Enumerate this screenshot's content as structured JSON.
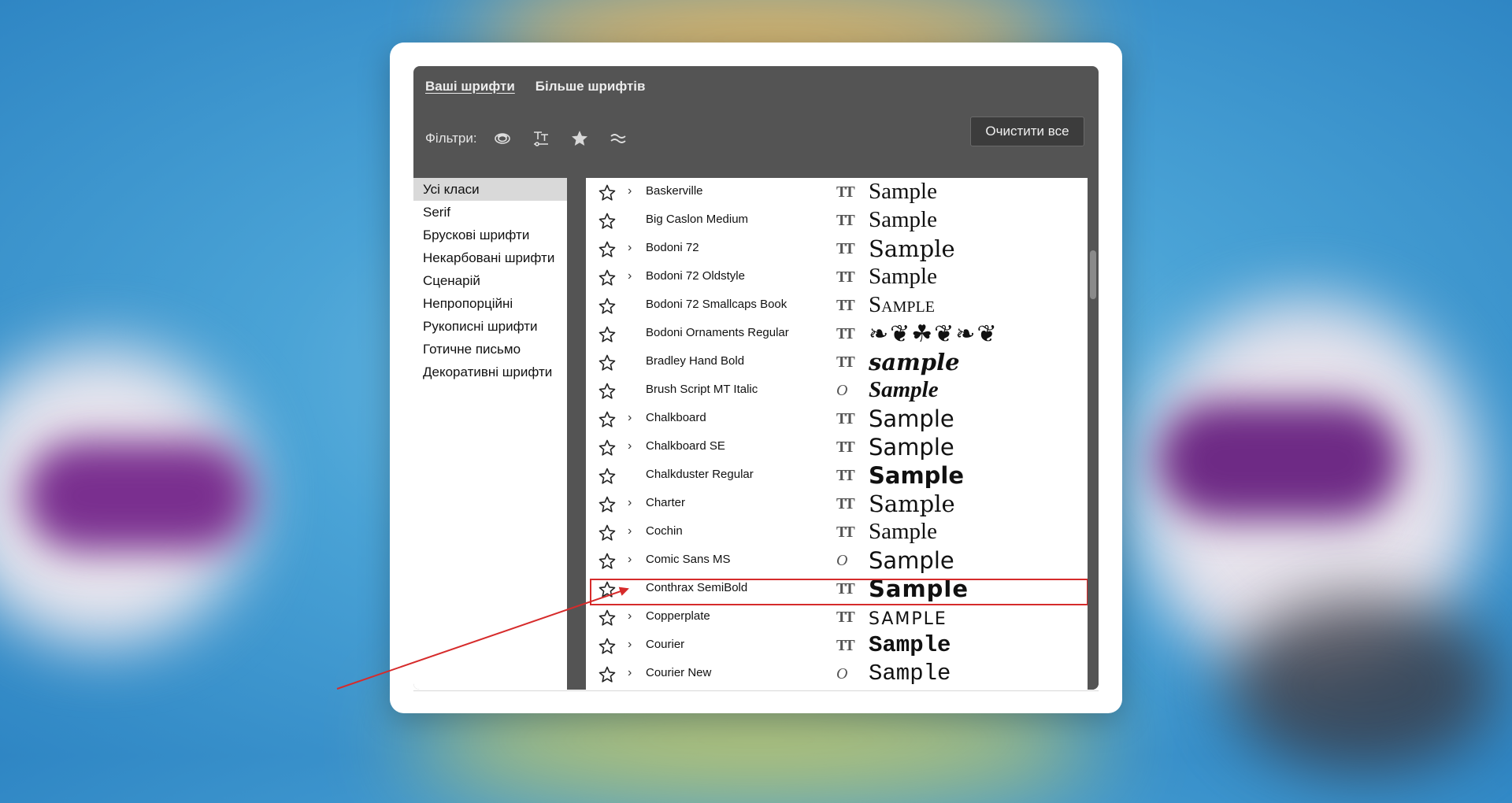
{
  "tabs": [
    {
      "label": "Ваші шрифти",
      "active": true
    },
    {
      "label": "Більше шрифтів",
      "active": false
    }
  ],
  "filters": {
    "label": "Фільтри:",
    "icons": [
      "creative-cloud-icon",
      "text-tool-icon",
      "star-icon",
      "similar-icon"
    ]
  },
  "clear_button": "Очистити все",
  "classes": [
    "Усі класи",
    "Serif",
    "Брускові шрифти",
    "Некарбовані шрифти",
    "Сценарій",
    "Непропорційні",
    "Рукописні шрифти",
    "Готичне письмо",
    "Декоративні шрифти"
  ],
  "selected_class": "Усі класи",
  "fonts": [
    {
      "name": "Baskerville",
      "expandable": true,
      "type": "truetype",
      "sample": "Sample"
    },
    {
      "name": "Big Caslon Medium",
      "expandable": false,
      "type": "truetype",
      "sample": "Sample"
    },
    {
      "name": "Bodoni 72",
      "expandable": true,
      "type": "truetype",
      "sample": "Sample"
    },
    {
      "name": "Bodoni 72 Oldstyle",
      "expandable": true,
      "type": "truetype",
      "sample": "Sample"
    },
    {
      "name": "Bodoni 72 Smallcaps Book",
      "expandable": false,
      "type": "truetype",
      "sample": "Sample"
    },
    {
      "name": "Bodoni Ornaments Regular",
      "expandable": false,
      "type": "truetype",
      "sample": "❧❦☘❦❧❦"
    },
    {
      "name": "Bradley Hand Bold",
      "expandable": false,
      "type": "truetype",
      "sample": "sample"
    },
    {
      "name": "Brush Script MT Italic",
      "expandable": false,
      "type": "opentype",
      "sample": "Sample"
    },
    {
      "name": "Chalkboard",
      "expandable": true,
      "type": "truetype",
      "sample": "Sample"
    },
    {
      "name": "Chalkboard SE",
      "expandable": true,
      "type": "truetype",
      "sample": "Sample"
    },
    {
      "name": "Chalkduster Regular",
      "expandable": false,
      "type": "truetype",
      "sample": "Sample"
    },
    {
      "name": "Charter",
      "expandable": true,
      "type": "truetype",
      "sample": "Sample"
    },
    {
      "name": "Cochin",
      "expandable": true,
      "type": "truetype",
      "sample": "Sample"
    },
    {
      "name": "Comic Sans MS",
      "expandable": true,
      "type": "opentype",
      "sample": "Sample"
    },
    {
      "name": "Conthrax SemiBold",
      "expandable": false,
      "type": "truetype",
      "sample": "Sample",
      "highlighted": true
    },
    {
      "name": "Copperplate",
      "expandable": true,
      "type": "truetype",
      "sample": "SAMPLE"
    },
    {
      "name": "Courier",
      "expandable": true,
      "type": "truetype",
      "sample": "Sample"
    },
    {
      "name": "Courier New",
      "expandable": true,
      "type": "opentype",
      "sample": "Sample"
    }
  ],
  "colors": {
    "panel": "#545454",
    "highlight": "#d62b2b",
    "arrow": "#d62b2b",
    "selected_class_bg": "#d9d9d9"
  }
}
